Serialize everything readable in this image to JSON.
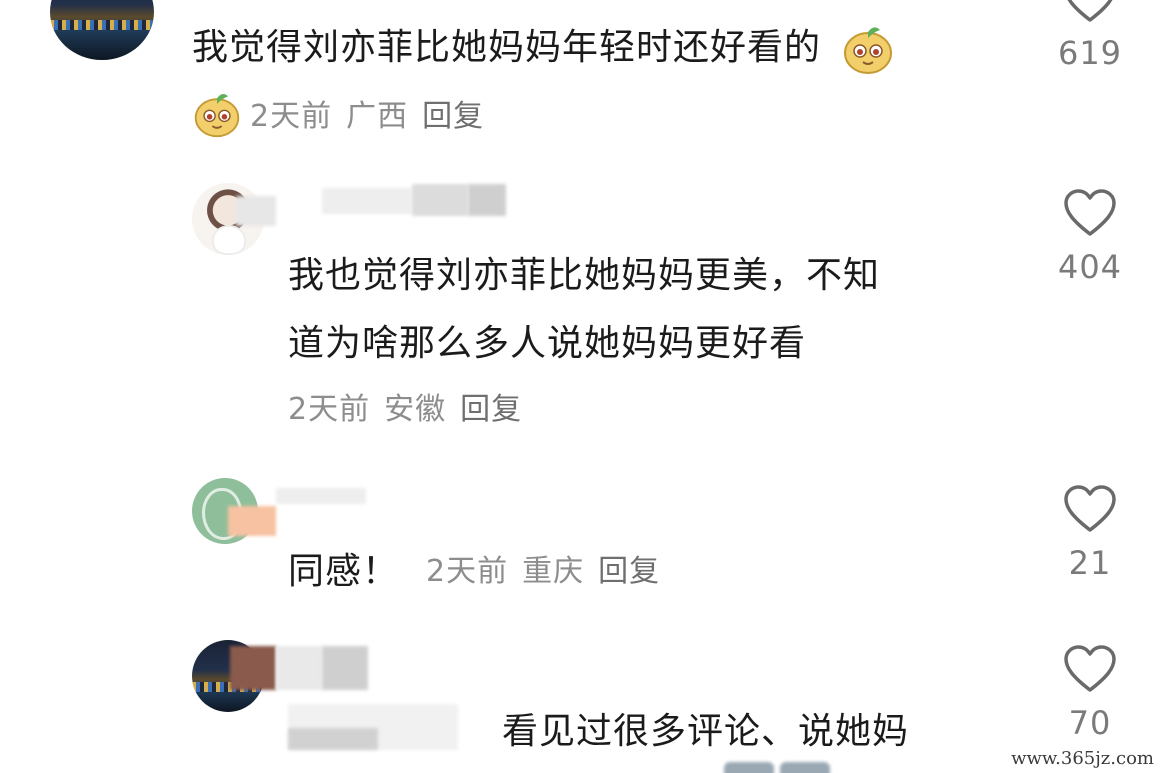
{
  "comments": [
    {
      "text": "我觉得刘亦菲比她妈妈年轻时还好看的",
      "emoji_icon": "cute-mascot-emoji",
      "time": "2天前",
      "location": "广西",
      "reply_label": "回复",
      "likes": "619"
    },
    {
      "text_line1": "我也觉得刘亦菲比她妈妈更美，不知",
      "text_line2": "道为啥那么多人说她妈妈更好看",
      "time": "2天前",
      "location": "安徽",
      "reply_label": "回复",
      "likes": "404"
    },
    {
      "text": "同感！",
      "time": "2天前",
      "location": "重庆",
      "reply_label": "回复",
      "likes": "21"
    },
    {
      "text": "看见过很多评论、说她妈",
      "likes": "70"
    }
  ],
  "watermark": "www.365jz.com",
  "colors": {
    "text": "#1b1b1b",
    "meta": "#8d8d8d",
    "heart": "#6a6a6a"
  }
}
